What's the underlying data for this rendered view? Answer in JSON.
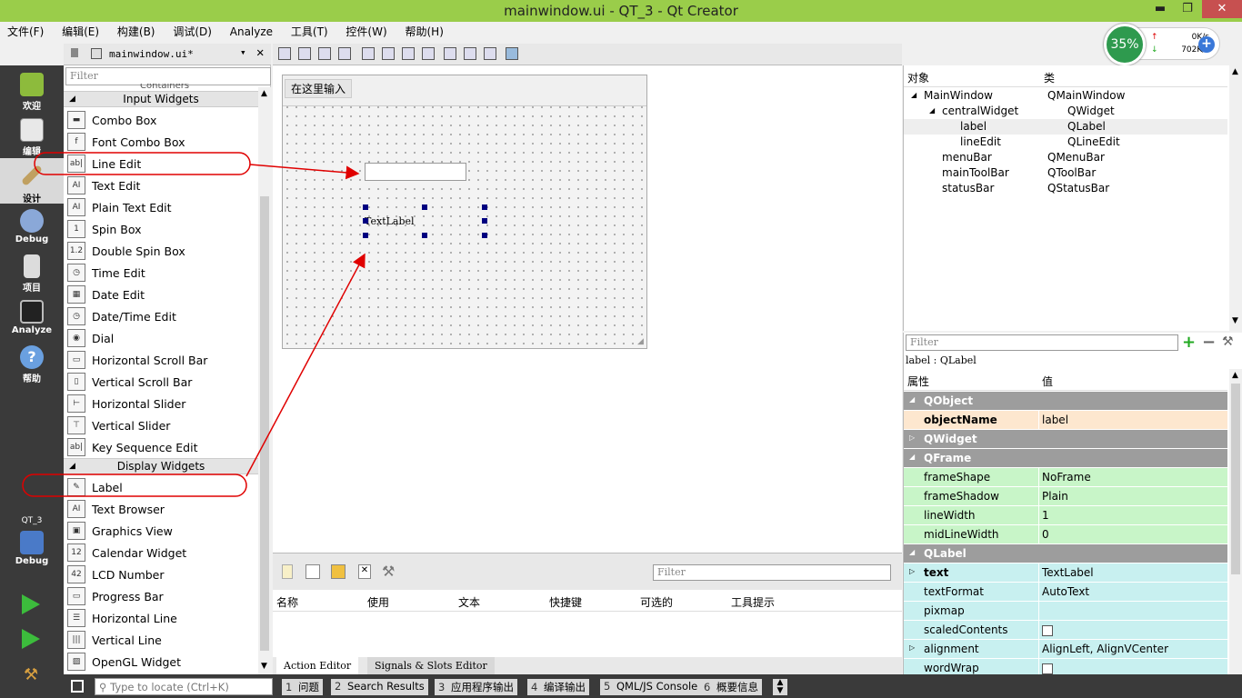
{
  "window": {
    "title": "mainwindow.ui - QT_3 - Qt Creator",
    "min": "▬",
    "max": "❐",
    "close": "✕"
  },
  "menubar": [
    "文件(F)",
    "编辑(E)",
    "构建(B)",
    "调试(D)",
    "Analyze",
    "工具(T)",
    "控件(W)",
    "帮助(H)"
  ],
  "speed": {
    "percent": "35%",
    "up": "0K/s",
    "down": "702K/s",
    "plus": "+"
  },
  "modes": [
    {
      "label": "欢迎",
      "color": "#8dbb3c"
    },
    {
      "label": "编辑",
      "color": "#e8e8e8"
    },
    {
      "label": "设计",
      "color": "#c0a060"
    },
    {
      "label": "Debug",
      "color": "#8aa8d8"
    },
    {
      "label": "项目",
      "color": "#dcdcdc"
    },
    {
      "label": "Analyze",
      "color": "#222222"
    },
    {
      "label": "帮助",
      "color": "#6aa0e0"
    }
  ],
  "kit": {
    "project": "QT_3",
    "config": "Debug"
  },
  "filetab": {
    "name": "mainwindow.ui*",
    "close": "✕"
  },
  "widgetbox": {
    "filter": "Filter",
    "partial_header": "Containers",
    "groups": [
      {
        "title": "Input Widgets",
        "items": [
          "Combo Box",
          "Font Combo Box",
          "Line Edit",
          "Text Edit",
          "Plain Text Edit",
          "Spin Box",
          "Double Spin Box",
          "Time Edit",
          "Date Edit",
          "Date/Time Edit",
          "Dial",
          "Horizontal Scroll Bar",
          "Vertical Scroll Bar",
          "Horizontal Slider",
          "Vertical Slider",
          "Key Sequence Edit"
        ]
      },
      {
        "title": "Display Widgets",
        "items": [
          "Label",
          "Text Browser",
          "Graphics View",
          "Calendar Widget",
          "LCD Number",
          "Progress Bar",
          "Horizontal Line",
          "Vertical Line",
          "OpenGL Widget"
        ]
      }
    ],
    "icons": [
      "▬",
      "f",
      "ab|",
      "AI",
      "AI",
      "1",
      "1.2",
      "◷",
      "▦",
      "◷",
      "◉",
      "▭",
      "▯",
      "⊢",
      "⊤",
      "ab|",
      "✎",
      "AI",
      "▣",
      "12",
      "42",
      "▭",
      "☰",
      "|||",
      "▨"
    ]
  },
  "form": {
    "menu_entry": "在这里输入",
    "label_text": "TextLabel"
  },
  "action_editor": {
    "filter": "Filter",
    "columns": [
      "名称",
      "使用",
      "文本",
      "快捷键",
      "可选的",
      "工具提示"
    ],
    "tabs": [
      "Action Editor",
      "Signals & Slots Editor"
    ]
  },
  "object_inspector": {
    "headers": [
      "对象",
      "类"
    ],
    "rows": [
      {
        "name": "MainWindow",
        "class": "QMainWindow"
      },
      {
        "name": "centralWidget",
        "class": "QWidget"
      },
      {
        "name": "label",
        "class": "QLabel"
      },
      {
        "name": "lineEdit",
        "class": "QLineEdit"
      },
      {
        "name": "menuBar",
        "class": "QMenuBar"
      },
      {
        "name": "mainToolBar",
        "class": "QToolBar"
      },
      {
        "name": "statusBar",
        "class": "QStatusBar"
      }
    ]
  },
  "property_editor": {
    "filter": "Filter",
    "context": "label : QLabel",
    "headers": [
      "属性",
      "值"
    ],
    "rows": [
      {
        "name": "QObject",
        "value": "",
        "kind": "group"
      },
      {
        "name": "objectName",
        "value": "label",
        "kind": "obj"
      },
      {
        "name": "QWidget",
        "value": "",
        "kind": "group"
      },
      {
        "name": "QFrame",
        "value": "",
        "kind": "group"
      },
      {
        "name": "frameShape",
        "value": "NoFrame",
        "kind": "frame"
      },
      {
        "name": "frameShadow",
        "value": "Plain",
        "kind": "frame"
      },
      {
        "name": "lineWidth",
        "value": "1",
        "kind": "frame"
      },
      {
        "name": "midLineWidth",
        "value": "0",
        "kind": "frame"
      },
      {
        "name": "QLabel",
        "value": "",
        "kind": "group"
      },
      {
        "name": "text",
        "value": "TextLabel",
        "kind": "label"
      },
      {
        "name": "textFormat",
        "value": "AutoText",
        "kind": "label"
      },
      {
        "name": "pixmap",
        "value": "",
        "kind": "label"
      },
      {
        "name": "scaledContents",
        "value": "",
        "kind": "label"
      },
      {
        "name": "alignment",
        "value": "AlignLeft, AlignVCenter",
        "kind": "label"
      },
      {
        "name": "wordWrap",
        "value": "",
        "kind": "label"
      }
    ]
  },
  "statusbar": {
    "locate_placeholder": "Type to locate (Ctrl+K)",
    "panes": [
      {
        "num": "1",
        "label": "问题"
      },
      {
        "num": "2",
        "label": "Search Results"
      },
      {
        "num": "3",
        "label": "应用程序输出"
      },
      {
        "num": "4",
        "label": "编译输出"
      },
      {
        "num": "5",
        "label": "QML/JS Console"
      },
      {
        "num": "6",
        "label": "概要信息"
      }
    ]
  },
  "colors": {
    "title_bg": "#9acd4a",
    "frame_row": "#c8f5c8",
    "label_row": "#c8f0f0",
    "obj_row": "#fde7cf",
    "annotation": "#e00000"
  }
}
